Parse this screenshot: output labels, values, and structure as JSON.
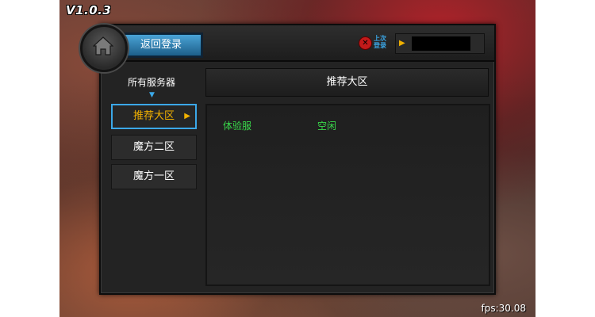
{
  "version": "V1.0.3",
  "fps": "fps:30.08",
  "header": {
    "back_label": "返回登录",
    "last_login_label": "上次登录",
    "last_login_value": ""
  },
  "sidebar": {
    "title": "所有服务器",
    "items": [
      {
        "label": "推荐大区",
        "selected": true
      },
      {
        "label": "魔方二区",
        "selected": false
      },
      {
        "label": "魔方一区",
        "selected": false
      }
    ]
  },
  "main": {
    "region_title": "推荐大区",
    "servers": [
      {
        "name": "体验服",
        "status": "空闲"
      }
    ]
  },
  "colors": {
    "accent_blue": "#3ba8e8",
    "selected_gold": "#f0b000",
    "server_green": "#39d84a"
  }
}
